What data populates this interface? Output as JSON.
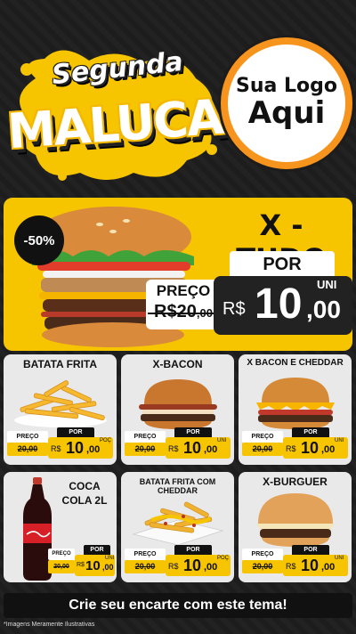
{
  "header": {
    "title_top": "Segunda",
    "title_main": "MALUCA",
    "logo_line1": "Sua Logo",
    "logo_line2": "Aqui"
  },
  "featured": {
    "discount": "-50%",
    "name": "X - TUDO",
    "por_label": "POR",
    "preco_label": "PREÇO",
    "old_price": "R$20,00",
    "old_price_main": "R$20",
    "old_price_cents": ",00",
    "currency": "R$",
    "price_int": "10",
    "price_cents": ",00",
    "unit": "UNI"
  },
  "products": [
    {
      "name": "BATATA FRITA",
      "image": "fries-icon",
      "preco_label": "PREÇO",
      "old_price": "20,00",
      "por_label": "POR",
      "currency": "R$",
      "price_int": "10",
      "price_cents": ",00",
      "unit": "POÇ"
    },
    {
      "name": "X-BACON",
      "image": "bacon-burger-icon",
      "preco_label": "PREÇO",
      "old_price": "20,00",
      "por_label": "POR",
      "currency": "R$",
      "price_int": "10",
      "price_cents": ",00",
      "unit": "UNI"
    },
    {
      "name": "X BACON E CHEDDAR",
      "image": "cheddar-burger-icon",
      "preco_label": "PREÇO",
      "old_price": "20,00",
      "por_label": "POR",
      "currency": "R$",
      "price_int": "10",
      "price_cents": ",00",
      "unit": "UNI"
    },
    {
      "name": "COCA COLA 2L",
      "image": "soda-bottle-icon",
      "preco_label": "PREÇO",
      "old_price": "20,00",
      "por_label": "POR",
      "currency": "R$",
      "price_int": "10",
      "price_cents": ",00",
      "unit": "UNI"
    },
    {
      "name": "BATATA FRITA COM CHEDDAR",
      "image": "cheddar-fries-icon",
      "preco_label": "PREÇO",
      "old_price": "20,00",
      "por_label": "POR",
      "currency": "R$",
      "price_int": "10",
      "price_cents": ",00",
      "unit": "POÇ"
    },
    {
      "name": "X-BURGUER",
      "image": "burger-icon",
      "preco_label": "PREÇO",
      "old_price": "20,00",
      "por_label": "POR",
      "currency": "R$",
      "price_int": "10",
      "price_cents": ",00",
      "unit": "UNI"
    }
  ],
  "footer": {
    "cta": "Crie seu encarte com este tema!",
    "disclaimer": "*Imagens Meramente Ilustrativas"
  },
  "colors": {
    "accent_yellow": "#f7c400",
    "logo_ring": "#f7941d",
    "dark": "#1c1c1c"
  }
}
